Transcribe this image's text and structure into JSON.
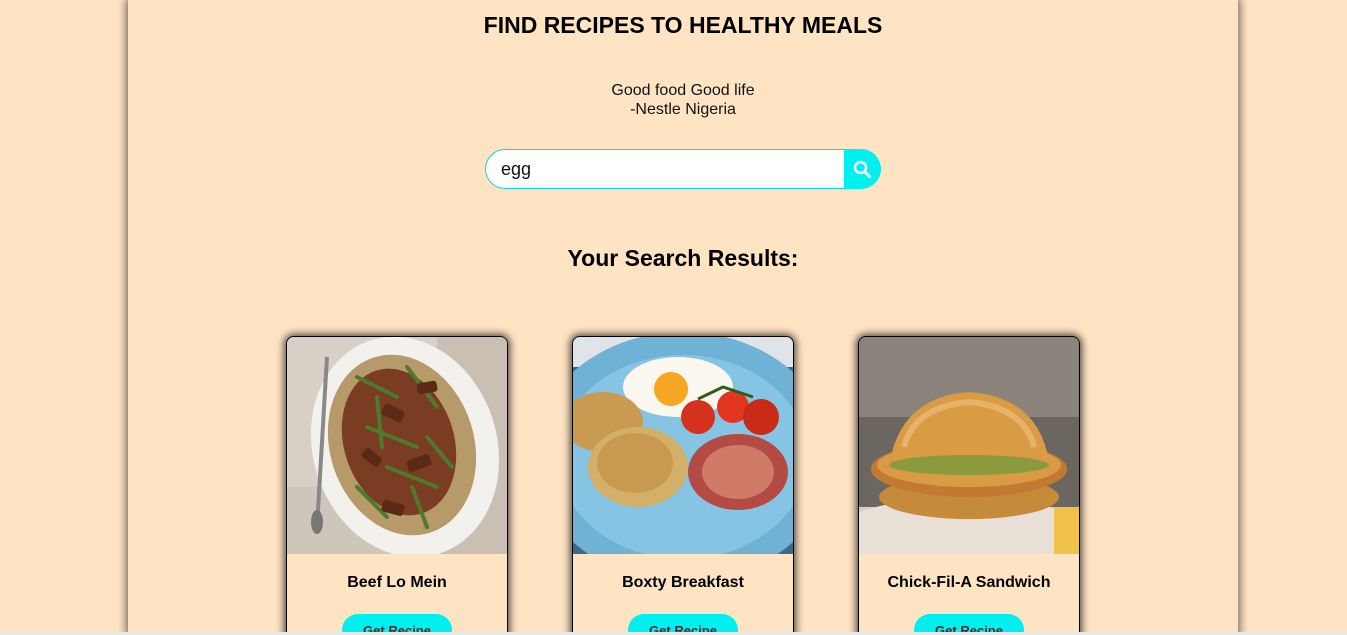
{
  "header": {
    "title": "FIND RECIPES TO HEALTHY MEALS",
    "quote_line1": "Good food Good life",
    "quote_line2": "-Nestle Nigeria"
  },
  "search": {
    "value": "egg",
    "button_icon": "search-icon"
  },
  "results": {
    "title": "Your Search Results:",
    "cards": [
      {
        "name": "Beef Lo Mein",
        "button": "Get Recipe"
      },
      {
        "name": "Boxty Breakfast",
        "button": "Get Recipe"
      },
      {
        "name": "Chick-Fil-A Sandwich",
        "button": "Get Recipe"
      }
    ]
  },
  "colors": {
    "background": "#ffe4c4",
    "accent": "#00f0f0"
  }
}
